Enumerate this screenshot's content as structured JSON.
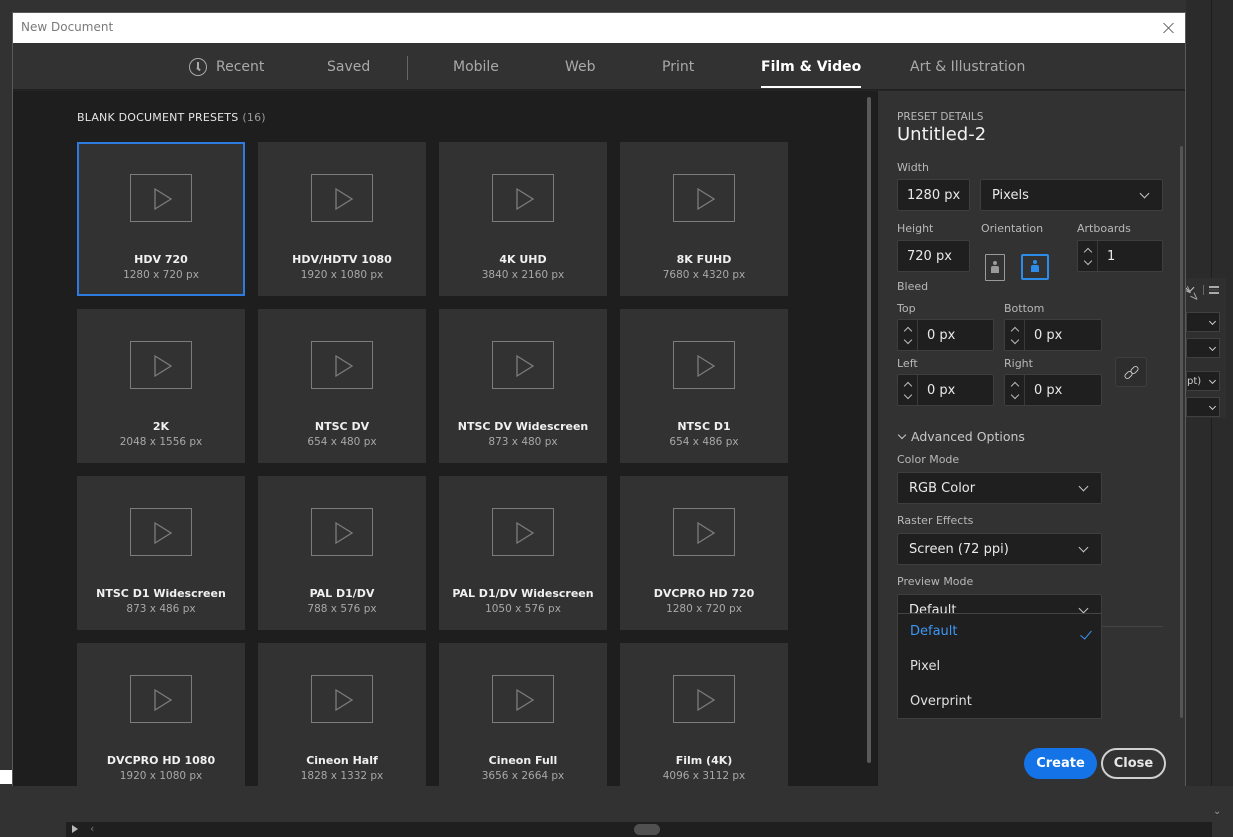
{
  "dialog": {
    "title": "New Document"
  },
  "tabs": [
    {
      "label": "Recent",
      "icon": "clock-icon"
    },
    {
      "label": "Saved"
    },
    {
      "label": "Mobile"
    },
    {
      "label": "Web"
    },
    {
      "label": "Print"
    },
    {
      "label": "Film & Video",
      "active": true
    },
    {
      "label": "Art & Illustration"
    }
  ],
  "presets": {
    "heading": "BLANK DOCUMENT PRESETS",
    "count": "(16)",
    "items": [
      {
        "name": "HDV 720",
        "dims": "1280 x 720 px",
        "selected": true
      },
      {
        "name": "HDV/HDTV 1080",
        "dims": "1920 x 1080 px"
      },
      {
        "name": "4K UHD",
        "dims": "3840 x 2160 px"
      },
      {
        "name": "8K FUHD",
        "dims": "7680 x 4320 px"
      },
      {
        "name": "2K",
        "dims": "2048 x 1556 px"
      },
      {
        "name": "NTSC DV",
        "dims": "654 x 480 px"
      },
      {
        "name": "NTSC DV Widescreen",
        "dims": "873 x 480 px"
      },
      {
        "name": "NTSC D1",
        "dims": "654 x 486 px"
      },
      {
        "name": "NTSC D1 Widescreen",
        "dims": "873 x 486 px"
      },
      {
        "name": "PAL D1/DV",
        "dims": "788 x 576 px"
      },
      {
        "name": "PAL D1/DV Widescreen",
        "dims": "1050 x 576 px"
      },
      {
        "name": "DVCPRO HD 720",
        "dims": "1280 x 720 px"
      },
      {
        "name": "DVCPRO HD 1080",
        "dims": "1920 x 1080 px"
      },
      {
        "name": "Cineon Half",
        "dims": "1828 x 1332 px"
      },
      {
        "name": "Cineon Full",
        "dims": "3656 x 2664 px"
      },
      {
        "name": "Film (4K)",
        "dims": "4096 x 3112 px"
      }
    ]
  },
  "details": {
    "section_label": "PRESET DETAILS",
    "doc_name": "Untitled-2",
    "width_label": "Width",
    "width_value": "1280 px",
    "units_value": "Pixels",
    "height_label": "Height",
    "height_value": "720 px",
    "orientation_label": "Orientation",
    "orientation_selected": "landscape",
    "artboards_label": "Artboards",
    "artboards_value": "1",
    "bleed_label": "Bleed",
    "bleed": {
      "top_label": "Top",
      "top_value": "0 px",
      "bottom_label": "Bottom",
      "bottom_value": "0 px",
      "left_label": "Left",
      "left_value": "0 px",
      "right_label": "Right",
      "right_value": "0 px"
    },
    "advanced_label": "Advanced Options",
    "color_mode_label": "Color Mode",
    "color_mode_value": "RGB Color",
    "raster_label": "Raster Effects",
    "raster_value": "Screen (72 ppi)",
    "preview_label": "Preview Mode",
    "preview_value": "Default",
    "preview_options": [
      "Default",
      "Pixel",
      "Overprint"
    ],
    "create_label": "Create",
    "close_label": "Close"
  },
  "background_panel": {
    "row3_text": "pt)"
  },
  "colors": {
    "accent": "#1473e6",
    "selection": "#2d7ae0",
    "check": "#3d97f5"
  }
}
